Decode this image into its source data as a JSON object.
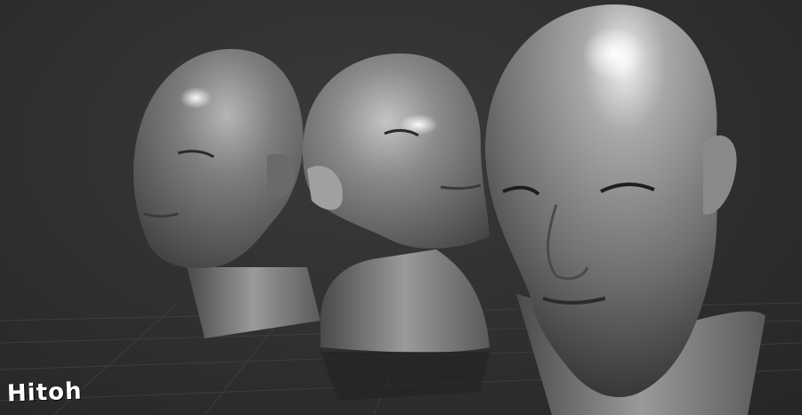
{
  "scene": {
    "description_icon": "3d-viewport",
    "background_color": "#2f2f2f",
    "grid_color": "#3d3d3d",
    "model_color": "#8a8a8a",
    "models": [
      "left-head",
      "middle-head",
      "right-head"
    ]
  },
  "watermark": {
    "signature_text": "Hitoh"
  }
}
